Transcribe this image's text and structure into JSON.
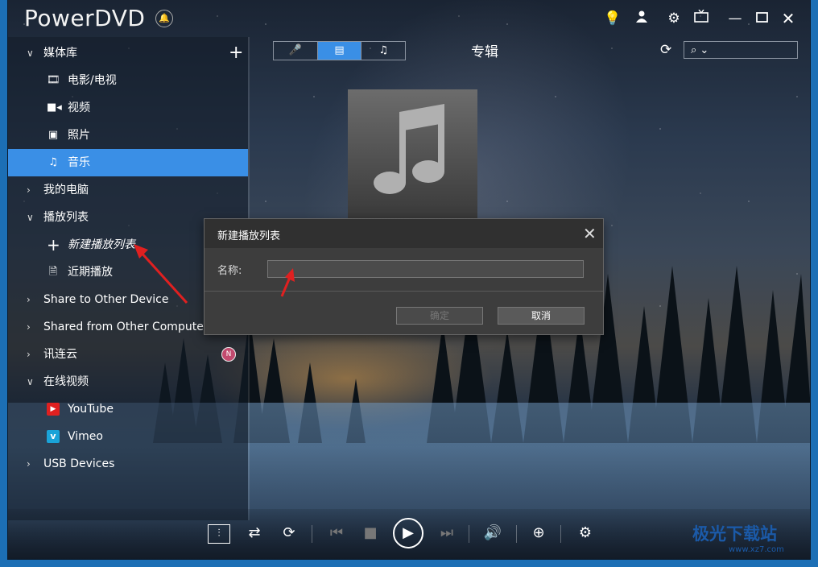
{
  "app": {
    "title": "PowerDVD"
  },
  "titlebar_icons": [
    "lightbulb-icon",
    "user-icon",
    "gear-icon",
    "tv-mode-icon",
    "minimize-icon",
    "maximize-icon",
    "close-icon"
  ],
  "sidebar": {
    "media_library": "媒体库",
    "items": [
      {
        "label": "电影/电视",
        "icon": "film-icon"
      },
      {
        "label": "视频",
        "icon": "video-icon"
      },
      {
        "label": "照片",
        "icon": "photo-icon"
      },
      {
        "label": "音乐",
        "icon": "music-icon",
        "active": true
      }
    ],
    "my_computer": "我的电脑",
    "playlists": "播放列表",
    "new_playlist": "新建播放列表",
    "recent": "近期播放",
    "share_to": "Share to Other Device",
    "shared_from": "Shared from Other Computer",
    "cloud": "讯连云",
    "cloud_badge": "N",
    "online_video": "在线视频",
    "youtube": "YouTube",
    "vimeo": "Vimeo",
    "usb": "USB Devices"
  },
  "main": {
    "view_title": "专辑",
    "search_placeholder": ""
  },
  "dialog": {
    "title": "新建播放列表",
    "name_label": "名称:",
    "name_value": "",
    "ok_label": "确定",
    "cancel_label": "取消"
  },
  "watermark": {
    "text": "极光下载站",
    "url": "www.xz7.com"
  },
  "colors": {
    "accent": "#3a8fe6",
    "arrow": "#e02020",
    "badge": "#c24b6f"
  }
}
